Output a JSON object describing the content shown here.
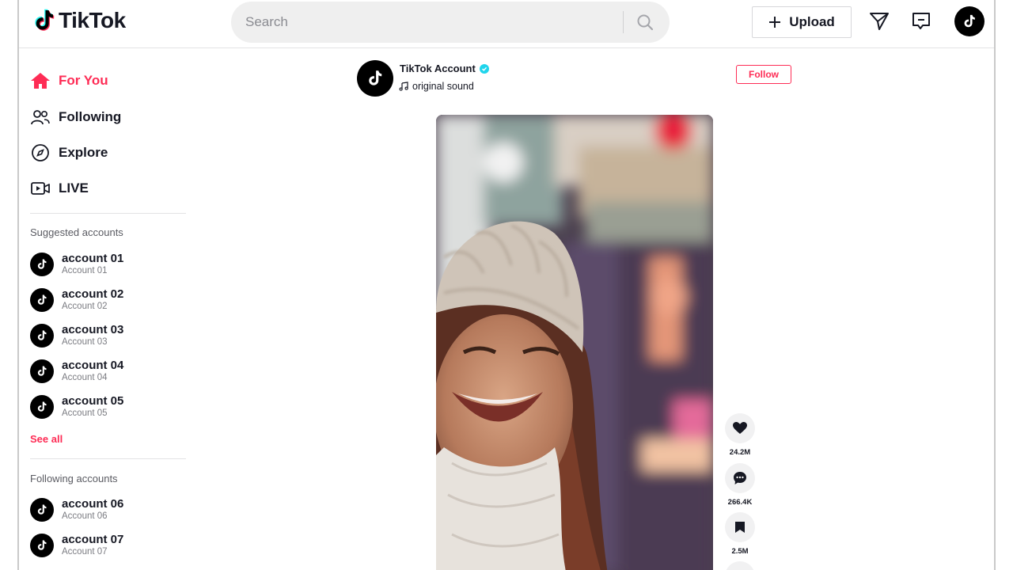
{
  "header": {
    "logo_text": "TikTok",
    "search_placeholder": "Search",
    "upload_label": "Upload"
  },
  "sidebar": {
    "nav": [
      {
        "label": "For You",
        "icon": "home-icon",
        "active": true
      },
      {
        "label": "Following",
        "icon": "users-icon"
      },
      {
        "label": "Explore",
        "icon": "compass-icon"
      },
      {
        "label": "LIVE",
        "icon": "live-icon"
      }
    ],
    "suggested_title": "Suggested accounts",
    "suggested": [
      {
        "name": "account 01",
        "sub": "Account 01"
      },
      {
        "name": "account 02",
        "sub": "Account 02"
      },
      {
        "name": "account 03",
        "sub": "Account 03"
      },
      {
        "name": "account 04",
        "sub": "Account 04"
      },
      {
        "name": "account 05",
        "sub": "Account 05"
      }
    ],
    "see_all": "See all",
    "following_title": "Following accounts",
    "following": [
      {
        "name": "account 06",
        "sub": "Account 06"
      },
      {
        "name": "account 07",
        "sub": "Account 07"
      }
    ]
  },
  "post": {
    "author": "TikTok Account",
    "sound": "original sound",
    "follow_label": "Follow",
    "likes": "24.2M",
    "comments": "266.4K",
    "saves": "2.5M"
  },
  "colors": {
    "accent": "#fe2c55",
    "verified": "#20d5ec"
  }
}
